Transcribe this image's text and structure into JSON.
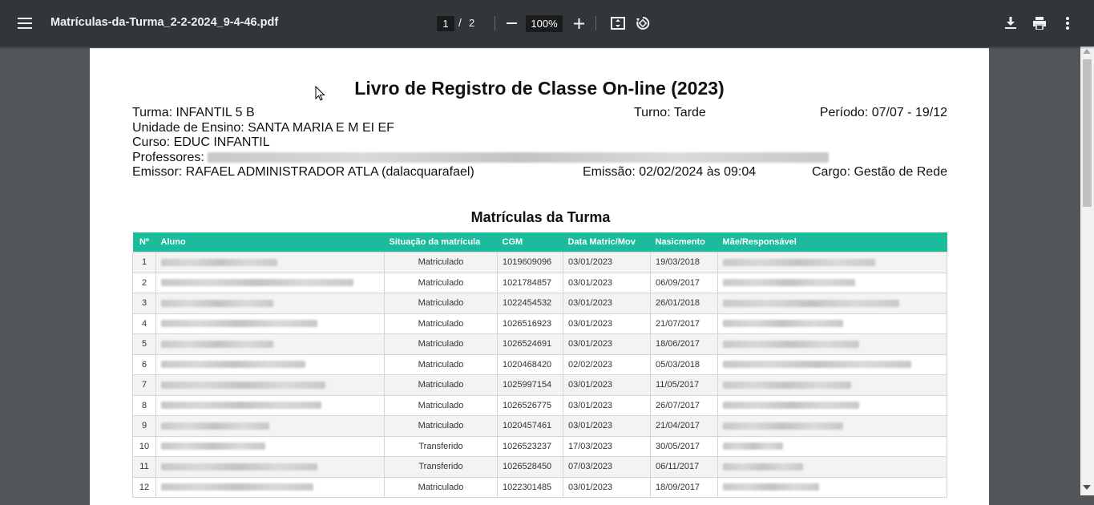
{
  "toolbar": {
    "file_name": "Matrículas-da-Turma_2-2-2024_9-4-46.pdf",
    "page_current": "1",
    "page_sep": "/",
    "page_total": "2",
    "zoom": "100%"
  },
  "report": {
    "title": "Livro de Registro de Classe On-line (2023)",
    "turma": "Turma: INFANTIL 5 B",
    "turno": "Turno: Tarde",
    "periodo": "Período: 07/07 - 19/12",
    "unidade": "Unidade de Ensino: SANTA MARIA E M EI EF",
    "curso": "Curso: EDUC INFANTIL",
    "professores": "Professores:",
    "emissor": "Emissor: RAFAEL ADMINISTRADOR ATLA (dalacquarafael)",
    "emissao": "Emissão: 02/02/2024 às 09:04",
    "cargo": "Cargo: Gestão de Rede",
    "section_title": "Matrículas da Turma"
  },
  "table": {
    "headers": [
      "Nº",
      "Aluno",
      "Situação da matrícula",
      "CGM",
      "Data Matric/Mov",
      "Nasicmento",
      "Mãe/Responsável"
    ],
    "rows": [
      {
        "no": "1",
        "situacao": "Matriculado",
        "cgm": "1019609096",
        "data": "03/01/2023",
        "nasc": "19/03/2018"
      },
      {
        "no": "2",
        "situacao": "Matriculado",
        "cgm": "1021784857",
        "data": "03/01/2023",
        "nasc": "06/09/2017"
      },
      {
        "no": "3",
        "situacao": "Matriculado",
        "cgm": "1022454532",
        "data": "03/01/2023",
        "nasc": "26/01/2018"
      },
      {
        "no": "4",
        "situacao": "Matriculado",
        "cgm": "1026516923",
        "data": "03/01/2023",
        "nasc": "21/07/2017"
      },
      {
        "no": "5",
        "situacao": "Matriculado",
        "cgm": "1026524691",
        "data": "03/01/2023",
        "nasc": "18/06/2017"
      },
      {
        "no": "6",
        "situacao": "Matriculado",
        "cgm": "1020468420",
        "data": "02/02/2023",
        "nasc": "05/03/2018"
      },
      {
        "no": "7",
        "situacao": "Matriculado",
        "cgm": "1025997154",
        "data": "03/01/2023",
        "nasc": "11/05/2017"
      },
      {
        "no": "8",
        "situacao": "Matriculado",
        "cgm": "1026526775",
        "data": "03/01/2023",
        "nasc": "26/07/2017"
      },
      {
        "no": "9",
        "situacao": "Matriculado",
        "cgm": "1020457461",
        "data": "03/01/2023",
        "nasc": "21/04/2017"
      },
      {
        "no": "10",
        "situacao": "Transferido",
        "cgm": "1026523237",
        "data": "17/03/2023",
        "nasc": "30/05/2017"
      },
      {
        "no": "11",
        "situacao": "Transferido",
        "cgm": "1026528450",
        "data": "07/03/2023",
        "nasc": "06/11/2017"
      },
      {
        "no": "12",
        "situacao": "Matriculado",
        "cgm": "1022301485",
        "data": "03/01/2023",
        "nasc": "18/09/2017"
      }
    ]
  },
  "colors": {
    "toolbar": "#323639",
    "header": "#1abc9c",
    "viewer_bg": "#525659"
  },
  "icons": [
    "menu-icon",
    "zoom-out-icon",
    "zoom-in-icon",
    "fit-page-icon",
    "rotate-icon",
    "download-icon",
    "print-icon",
    "more-vert-icon"
  ]
}
